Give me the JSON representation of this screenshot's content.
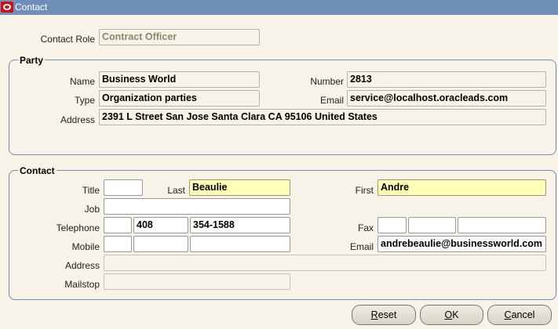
{
  "window": {
    "title": "Contact"
  },
  "contact_role": {
    "label": "Contact Role",
    "value": "Contract Officer"
  },
  "party": {
    "title": "Party",
    "name": {
      "label": "Name",
      "value": "Business World"
    },
    "number": {
      "label": "Number",
      "value": "2813"
    },
    "type": {
      "label": "Type",
      "value": "Organization parties"
    },
    "email": {
      "label": "Email",
      "value": "service@localhost.oracleads.com"
    },
    "address": {
      "label": "Address",
      "value": "2391 L Street San Jose Santa Clara CA 95106 United States"
    }
  },
  "contact": {
    "title": "Contact",
    "title_field": {
      "label": "Title",
      "value": ""
    },
    "last": {
      "label": "Last",
      "value": "Beaulie"
    },
    "first": {
      "label": "First",
      "value": "Andre"
    },
    "job": {
      "label": "Job",
      "value": ""
    },
    "telephone": {
      "label": "Telephone",
      "country": "",
      "area": "408",
      "number": "354-1588"
    },
    "fax": {
      "label": "Fax",
      "country": "",
      "area": "",
      "number": ""
    },
    "mobile": {
      "label": "Mobile",
      "country": "",
      "area": "",
      "number": ""
    },
    "email": {
      "label": "Email",
      "value": "andrebeaulie@businessworld.com"
    },
    "address": {
      "label": "Address",
      "value": ""
    },
    "mailstop": {
      "label": "Mailstop",
      "value": ""
    }
  },
  "buttons": {
    "reset": {
      "first": "R",
      "rest": "eset"
    },
    "ok": {
      "first": "O",
      "rest": "K"
    },
    "cancel": {
      "first": "C",
      "rest": "ancel"
    }
  }
}
